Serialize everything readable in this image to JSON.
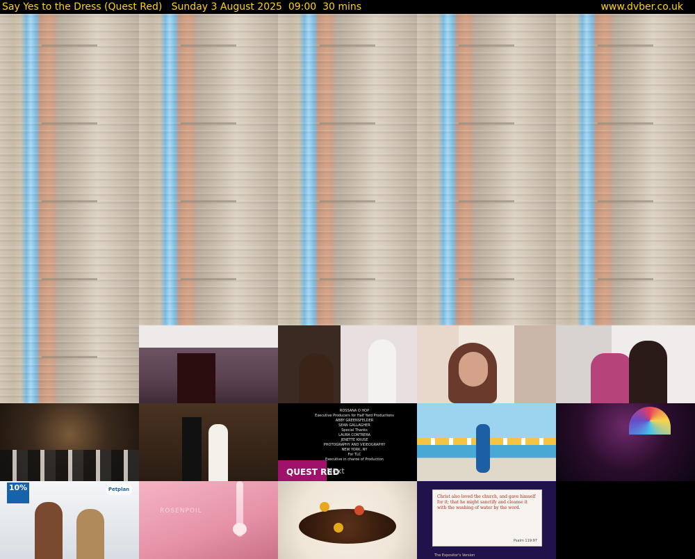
{
  "header": {
    "title": "Say Yes to the Dress (Quest Red)   Sunday 3 August 2025  09:00  30 mins",
    "site": "www.dvber.co.uk"
  },
  "credits": {
    "lines": [
      "ROSSANA O HOP",
      "Executive Producers for Half Yard Productions",
      "ABBY GREENSFELDER",
      "SEAN GALLAGHER",
      "Special Thanks",
      "LAURA CONTRERA",
      "JENETTE KRUSE",
      "PHOTOGRAPHY AND VIDEOGRAPHY",
      "NEW YORK, NY",
      "For TLC",
      "Executive in charge of Production"
    ],
    "logo": "QUEST RED",
    "next_label": "Next"
  },
  "ad": {
    "badge": "10%",
    "brand": "Petplan"
  },
  "pink_watermark": "ROSENPOIL",
  "scripture": {
    "text": "Christ also loved the church, and gave himself for it; that he might sanctify and cleanse it with the washing of water by the word.",
    "ref": "Psalm 119:97",
    "brand": "The Expositor's Version"
  }
}
